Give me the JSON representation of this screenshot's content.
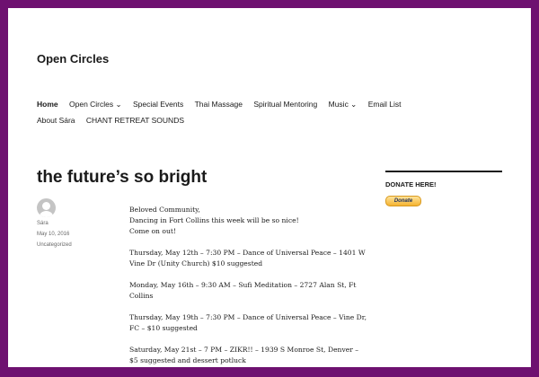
{
  "site_title": "Open Circles",
  "nav": [
    {
      "label": "Home",
      "active": true
    },
    {
      "label": "Open Circles ⌄"
    },
    {
      "label": "Special Events"
    },
    {
      "label": "Thai Massage"
    },
    {
      "label": "Spiritual Mentoring"
    },
    {
      "label": "Music ⌄"
    },
    {
      "label": "Email List"
    },
    {
      "label": "About Sára"
    },
    {
      "label": "CHANT RETREAT SOUNDS"
    }
  ],
  "post": {
    "title": "the future’s so bright",
    "author": "Sára",
    "date": "May 10, 2016",
    "category": "Uncategorized",
    "lines": {
      "l1": "Beloved Community,",
      "l2": "Dancing in Fort Collins this week will be so nice!",
      "l3": "Come on out!"
    },
    "paragraphs": [
      "Thursday, May 12th – 7:30 PM – Dance of Universal Peace – 1401 W Vine Dr (Unity Church) $10 suggested",
      "Monday, May 16th – 9:30 AM – Sufi Meditation – 2727 Alan St, Ft Collins",
      "Thursday, May 19th – 7:30 PM – Dance of Universal Peace – Vine Dr, FC – $10 suggested",
      "Saturday, May 21st – 7 PM – ZIKR!! – 1939 S Monroe St, Denver – $5 suggested and dessert potluck"
    ]
  },
  "sidebar": {
    "widget_title": "DONATE HERE!",
    "donate_label": "Donate"
  },
  "colors": {
    "frame": "#6e1170"
  }
}
